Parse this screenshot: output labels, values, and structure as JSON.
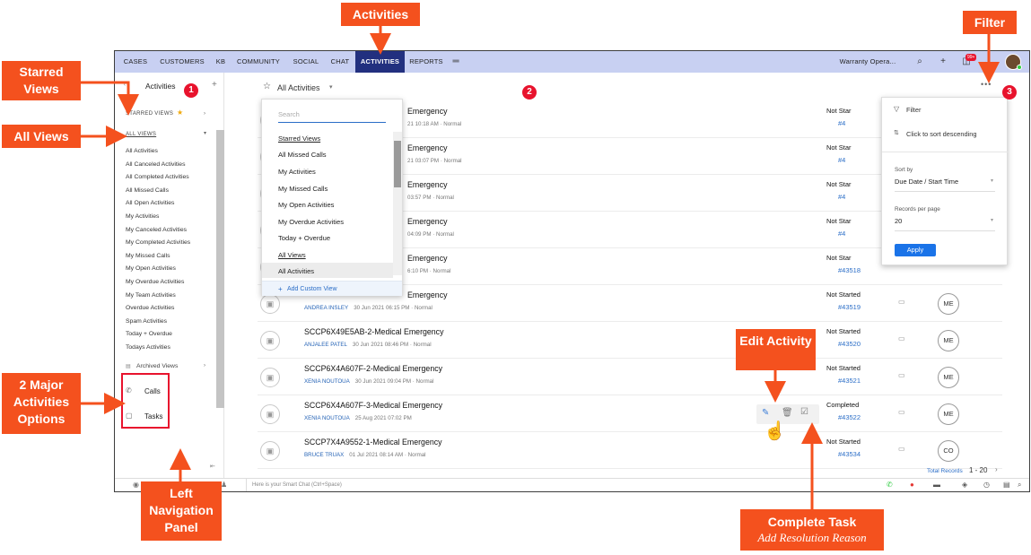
{
  "topnav": {
    "tabs": [
      "CASES",
      "CUSTOMERS",
      "KB",
      "COMMUNITY",
      "SOCIAL",
      "CHAT",
      "ACTIVITIES",
      "REPORTS"
    ],
    "department": "Warranty Opera...",
    "notification_count": "99+"
  },
  "leftnav": {
    "header": "Activities",
    "starred_label": "STARRED VIEWS",
    "all_views_label": "ALL VIEWS",
    "views": [
      "All Activities",
      "All Canceled Activities",
      "All Completed Activities",
      "All Missed Calls",
      "All Open Activities",
      "My Activities",
      "My Canceled Activities",
      "My Completed Activities",
      "My Missed Calls",
      "My Open Activities",
      "My Overdue Activities",
      "My Team Activities",
      "Overdue Activities",
      "Spam Activities",
      "Today + Overdue",
      "Todays Activities"
    ],
    "archived_label": "Archived Views",
    "calls_label": "Calls",
    "tasks_label": "Tasks"
  },
  "main": {
    "view_title": "All Activities",
    "total_records_label": "Total Records",
    "pager": "1 - 20"
  },
  "dropdown": {
    "search_placeholder": "Search",
    "starred_header": "Starred Views",
    "items1": [
      "All Missed Calls",
      "My Activities",
      "My Missed Calls",
      "My Open Activities",
      "My Overdue Activities",
      "Today + Overdue"
    ],
    "all_header": "All Views",
    "items2": [
      "All Activities"
    ],
    "add_custom": "Add Custom View"
  },
  "filter": {
    "filter_label": "Filter",
    "sort_hint": "Click to sort descending",
    "sort_by_label": "Sort by",
    "sort_by_value": "Due Date / Start Time",
    "records_label": "Records per page",
    "records_value": "20",
    "apply": "Apply"
  },
  "rows": [
    {
      "title": "Emergency",
      "sub": "21 10:18 AM",
      "priority": "Normal",
      "status": "Not Star",
      "num": "#4"
    },
    {
      "title": "Emergency",
      "sub": "21 03:07 PM",
      "priority": "Normal",
      "status": "Not Star",
      "num": "#4"
    },
    {
      "title": "Emergency",
      "sub": "03:57 PM",
      "priority": "Normal",
      "status": "Not Star",
      "num": "#4"
    },
    {
      "title": "Emergency",
      "sub": "04:09 PM",
      "priority": "Normal",
      "status": "Not Star",
      "num": "#4"
    },
    {
      "title": "Emergency",
      "sub": "6:10 PM",
      "priority": "Normal",
      "status": "Not Star",
      "num": "#43518"
    },
    {
      "title": "Emergency",
      "name": "ANDREA INSLEY",
      "sub": "30 Jun 2021 06:15 PM",
      "priority": "Normal",
      "status": "Not Started",
      "num": "#43519",
      "owner": "ME"
    },
    {
      "title": "SCCP6X49E5AB-2-Medical Emergency",
      "name": "ANJALEE PATEL",
      "sub": "30 Jun 2021 08:46 PM",
      "priority": "Normal",
      "status": "Not Started",
      "num": "#43520",
      "owner": "ME"
    },
    {
      "title": "SCCP6X4A607F-2-Medical Emergency",
      "name": "XENIA NOUTOUA",
      "sub": "30 Jun 2021 09:04 PM",
      "priority": "Normal",
      "status": "Not Started",
      "num": "#43521",
      "owner": "ME"
    },
    {
      "title": "SCCP6X4A607F-3-Medical Emergency",
      "name": "XENIA NOUTOUA",
      "sub": "25 Aug 2021 07:02 PM",
      "priority": "",
      "status": "Completed",
      "num": "#43522",
      "owner": "ME"
    },
    {
      "title": "SCCP7X4A9552-1-Medical Emergency",
      "name": "BRUCE TRUAX",
      "sub": "01 Jul 2021 08:14 AM",
      "priority": "Normal",
      "status": "Not Started",
      "num": "#43534",
      "owner": "CO"
    }
  ],
  "bottom": {
    "chat_placeholder": "Here is your Smart Chat (Ctrl+Space)"
  },
  "annotations": {
    "activities": "Activities",
    "filter": "Filter",
    "starred_views": "Starred Views",
    "all_views": "All Views",
    "two_major": "2 Major Activities Options",
    "left_nav": "Left Navigation Panel",
    "edit_activity": "Edit Activity",
    "complete_task": "Complete Task",
    "complete_task_sub": "Add Resolution Reason",
    "badge1": "1",
    "badge2": "2",
    "badge3": "3"
  },
  "colors": {
    "nav_bg": "#c8d0f2",
    "nav_active": "#22307f",
    "callout": "#f4511e",
    "badge": "#e8132d",
    "link": "#2563b6",
    "apply": "#1a73e8"
  }
}
